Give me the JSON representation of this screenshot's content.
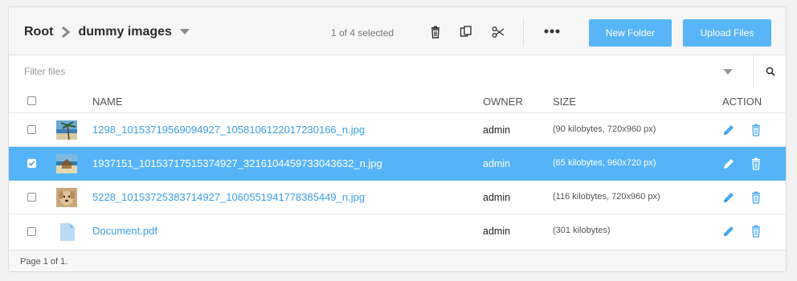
{
  "breadcrumb": {
    "root": "Root",
    "current": "dummy images"
  },
  "toolbar": {
    "selection_count": "1 of 4 selected",
    "new_folder_label": "New Folder",
    "upload_label": "Upload Files"
  },
  "filter": {
    "placeholder": "Filter files"
  },
  "columns": {
    "name": "NAME",
    "owner": "OWNER",
    "size": "SIZE",
    "action": "ACTION"
  },
  "files": [
    {
      "name": "1298_10153719569094927_1058106122017230166_n.jpg",
      "owner": "admin",
      "size": "(90 kilobytes, 720x960 px)",
      "selected": false,
      "icon": "image-thumbnail-beach-palm"
    },
    {
      "name": "1937151_10153717515374927_3216104459733043632_n.jpg",
      "owner": "admin",
      "size": "(65 kilobytes, 960x720 px)",
      "selected": true,
      "icon": "image-thumbnail-beach-hut"
    },
    {
      "name": "5228_10153725383714927_1060551941778385449_n.jpg",
      "owner": "admin",
      "size": "(116 kilobytes, 720x960 px)",
      "selected": false,
      "icon": "image-thumbnail-dog"
    },
    {
      "name": "Document.pdf",
      "owner": "admin",
      "size": "(301 kilobytes)",
      "selected": false,
      "icon": "document-icon"
    }
  ],
  "pager": {
    "text": "Page 1 of 1."
  },
  "colors": {
    "accent": "#58b5f7",
    "link": "#3a9fe8",
    "selected_row": "#55b4f8"
  }
}
